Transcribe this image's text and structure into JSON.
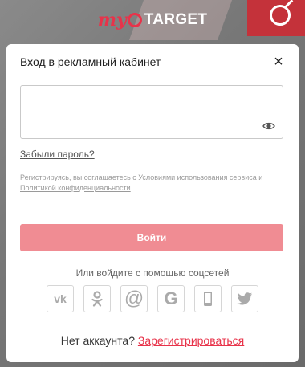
{
  "logo": {
    "my": "my",
    "target": "TARGET"
  },
  "modal": {
    "title": "Вход в рекламный кабинет",
    "close": "×",
    "login_field": {
      "value": "",
      "placeholder": ""
    },
    "password_field": {
      "value": "",
      "placeholder": ""
    },
    "forgot_password": "Забыли пароль?",
    "terms": {
      "prefix": "Регистрируясь, вы соглашаетесь с ",
      "terms_link": "Условиями использования сервиса",
      "and": " и ",
      "privacy_link": "Политикой конфиденциальности"
    },
    "login_button": "Войти",
    "social_label": "Или войдите с помощью соцсетей",
    "social": [
      {
        "icon": "vk-icon",
        "text": "vk"
      },
      {
        "icon": "odnoklassniki-icon",
        "text": ""
      },
      {
        "icon": "mail-ru-icon",
        "text": "@"
      },
      {
        "icon": "google-icon",
        "text": "G"
      },
      {
        "icon": "phone-icon",
        "text": ""
      },
      {
        "icon": "twitter-icon",
        "text": ""
      }
    ],
    "no_account": "Нет аккаунта?",
    "register_link": "Зарегистрироваться"
  },
  "colors": {
    "accent": "#e8334a",
    "button_disabled": "#f08c93",
    "backdrop": "#777777"
  }
}
